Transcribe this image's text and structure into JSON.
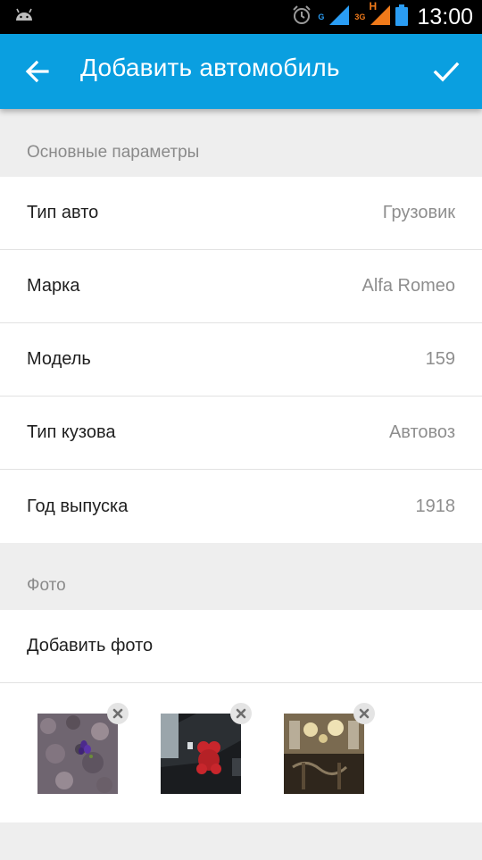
{
  "status_bar": {
    "time": "13:00",
    "network_g": "G",
    "network_3g": "3G",
    "network_h": "H",
    "icons": [
      "android-icon",
      "alarm-icon",
      "signal-icon",
      "battery-icon"
    ]
  },
  "app_bar": {
    "title": "Добавить автомобиль",
    "back_icon": "arrow-left-icon",
    "save_icon": "check-icon"
  },
  "sections": {
    "main": {
      "header": "Основные параметры",
      "rows": [
        {
          "label": "Тип авто",
          "value": "Грузовик"
        },
        {
          "label": "Марка",
          "value": "Alfa Romeo"
        },
        {
          "label": "Модель",
          "value": "159"
        },
        {
          "label": "Тип кузова",
          "value": "Автовоз"
        },
        {
          "label": "Год выпуска",
          "value": "1918"
        }
      ]
    },
    "photo": {
      "header": "Фото",
      "add_label": "Добавить фото",
      "thumbnails": [
        "flower-photo",
        "bear-photo",
        "chandelier-photo"
      ],
      "remove_icon": "close-icon"
    }
  },
  "colors": {
    "accent": "#0a9fe0",
    "background": "#eeeeee",
    "row_background": "#ffffff",
    "value_text": "#8e8e8e"
  }
}
